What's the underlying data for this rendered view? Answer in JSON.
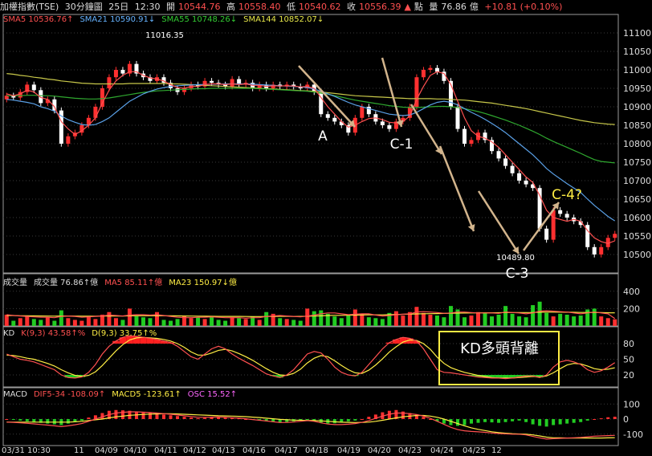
{
  "header": {
    "instrument": "加權指數(TSE)",
    "period": "30分鐘圖",
    "date": "25日",
    "time": "12:30",
    "open_label": "開",
    "open": "10544.76",
    "high_label": "高",
    "high": "10558.40",
    "low_label": "低",
    "low": "10540.62",
    "close_label": "收",
    "close": "10556.39",
    "unit": "點",
    "vol_label": "量",
    "vol": "76.86",
    "vol_unit": "億",
    "change": "+10.81 (+0.10%)"
  },
  "price_legend": [
    {
      "text": "SMA5 10536.76↑",
      "color": "#ff5050"
    },
    {
      "text": "SMA21 10590.91↓",
      "color": "#66b3ff"
    },
    {
      "text": "SMA55 10748.26↓",
      "color": "#33cc33"
    },
    {
      "text": "SMA144 10852.07↓",
      "color": "#e8e84a"
    }
  ],
  "volume_legend": [
    {
      "text": "成交量",
      "color": "#dddddd"
    },
    {
      "text": "成交量 76.86↑億",
      "color": "#dddddd"
    },
    {
      "text": "MA5 85.11↑億",
      "color": "#ff5050"
    },
    {
      "text": "MA23 150.97↓億",
      "color": "#ffee44"
    }
  ],
  "kd_legend": [
    {
      "text": "KD",
      "color": "#dddddd"
    },
    {
      "text": "K(9,3) 43.58↑%",
      "color": "#ff5050"
    },
    {
      "text": "D(9,3) 33.75↑%",
      "color": "#ffee44"
    }
  ],
  "macd_legend": [
    {
      "text": "MACD",
      "color": "#dddddd"
    },
    {
      "text": "DIF5-34 -108.09↑",
      "color": "#ff5050"
    },
    {
      "text": "MACD5 -123.61↑",
      "color": "#ffee44"
    },
    {
      "text": "OSC 15.52↑",
      "color": "#ff66ff"
    }
  ],
  "annotations": {
    "high_label": "11016.35",
    "low_label": "10489.80",
    "wave_a": "A",
    "wave_c1": "C-1",
    "wave_c3": "C-3",
    "wave_c4": "C-4?",
    "kd_box": "KD多頭背離"
  },
  "chart_data": [
    {
      "type": "candlestick",
      "title": "加權指數(TSE) 30分鐘圖",
      "ylim": [
        10450,
        11150
      ],
      "y_ticks": [
        11100,
        11050,
        11000,
        10950,
        10900,
        10850,
        10800,
        10750,
        10700,
        10650,
        10600,
        10550,
        10500
      ],
      "x_labels": [
        "03/31 10:30",
        "11",
        "04/09",
        "04/10",
        "04/11",
        "04/12",
        "04/13",
        "04/16",
        "04/17",
        "04/18",
        "04/19",
        "04/20",
        "04/23",
        "04/24",
        "04/25",
        "12"
      ],
      "close_path": [
        10930,
        10925,
        10940,
        10960,
        10945,
        10910,
        10920,
        10890,
        10800,
        10820,
        10830,
        10850,
        10870,
        10900,
        10950,
        10980,
        11000,
        10990,
        11016,
        10990,
        10980,
        10970,
        10980,
        10965,
        10950,
        10940,
        10950,
        10960,
        10955,
        10970,
        10965,
        10960,
        10955,
        10975,
        10960,
        10965,
        10950,
        10960,
        10950,
        10960,
        10955,
        10960,
        10955,
        10950,
        10960,
        10940,
        10880,
        10870,
        10860,
        10850,
        10830,
        10870,
        10900,
        10880,
        10860,
        10850,
        10840,
        10860,
        10870,
        10900,
        10980,
        11000,
        11005,
        10995,
        10970,
        10900,
        10840,
        10800,
        10810,
        10830,
        10810,
        10780,
        10760,
        10740,
        10720,
        10700,
        10690,
        10680,
        10570,
        10540,
        10620,
        10610,
        10600,
        10590,
        10580,
        10520,
        10500,
        10520,
        10545,
        10556
      ],
      "sma5": [
        10935,
        10930,
        10935,
        10945,
        10940,
        10925,
        10920,
        10900,
        10860,
        10840,
        10825,
        10835,
        10850,
        10870,
        10910,
        10945,
        10970,
        10985,
        10995,
        10995,
        10985,
        10978,
        10975,
        10970,
        10960,
        10952,
        10950,
        10955,
        10955,
        10960,
        10962,
        10962,
        10960,
        10962,
        10960,
        10962,
        10958,
        10958,
        10955,
        10957,
        10956,
        10957,
        10956,
        10954,
        10955,
        10950,
        10925,
        10900,
        10880,
        10860,
        10845,
        10850,
        10860,
        10868,
        10870,
        10865,
        10858,
        10856,
        10860,
        10875,
        10920,
        10955,
        10985,
        10995,
        10990,
        10960,
        10915,
        10870,
        10835,
        10820,
        10815,
        10805,
        10790,
        10770,
        10750,
        10730,
        10710,
        10695,
        10660,
        10620,
        10600,
        10595,
        10590,
        10595,
        10590,
        10565,
        10545,
        10535,
        10530,
        10537
      ],
      "sma21": [
        10920,
        10918,
        10915,
        10912,
        10908,
        10900,
        10895,
        10888,
        10875,
        10865,
        10858,
        10852,
        10850,
        10852,
        10860,
        10870,
        10885,
        10900,
        10915,
        10925,
        10935,
        10942,
        10948,
        10952,
        10955,
        10957,
        10958,
        10959,
        10960,
        10960,
        10961,
        10961,
        10962,
        10962,
        10962,
        10962,
        10961,
        10960,
        10959,
        10958,
        10957,
        10956,
        10955,
        10954,
        10952,
        10948,
        10942,
        10935,
        10928,
        10920,
        10912,
        10905,
        10900,
        10895,
        10890,
        10885,
        10880,
        10878,
        10876,
        10878,
        10885,
        10895,
        10905,
        10912,
        10915,
        10912,
        10905,
        10895,
        10885,
        10876,
        10866,
        10855,
        10843,
        10830,
        10815,
        10800,
        10785,
        10770,
        10752,
        10733,
        10718,
        10705,
        10692,
        10680,
        10668,
        10650,
        10633,
        10618,
        10603,
        10591
      ],
      "sma55": [
        10930,
        10930,
        10930,
        10931,
        10931,
        10930,
        10930,
        10929,
        10927,
        10925,
        10923,
        10922,
        10921,
        10921,
        10922,
        10924,
        10927,
        10930,
        10933,
        10936,
        10939,
        10941,
        10943,
        10944,
        10945,
        10946,
        10947,
        10948,
        10949,
        10949,
        10950,
        10950,
        10950,
        10950,
        10950,
        10950,
        10950,
        10949,
        10948,
        10947,
        10946,
        10945,
        10944,
        10943,
        10942,
        10940,
        10937,
        10934,
        10930,
        10926,
        10922,
        10918,
        10915,
        10912,
        10909,
        10906,
        10903,
        10901,
        10899,
        10898,
        10898,
        10899,
        10900,
        10901,
        10901,
        10900,
        10898,
        10895,
        10891,
        10887,
        10882,
        10876,
        10870,
        10864,
        10857,
        10850,
        10842,
        10834,
        10825,
        10815,
        10806,
        10798,
        10790,
        10782,
        10774,
        10765,
        10757,
        10752,
        10750,
        10748
      ],
      "sma144": [
        10990,
        10988,
        10985,
        10983,
        10980,
        10978,
        10975,
        10973,
        10970,
        10968,
        10966,
        10964,
        10963,
        10962,
        10962,
        10962,
        10962,
        10962,
        10963,
        10963,
        10963,
        10963,
        10963,
        10963,
        10962,
        10962,
        10961,
        10960,
        10959,
        10958,
        10957,
        10956,
        10955,
        10954,
        10953,
        10952,
        10951,
        10950,
        10949,
        10948,
        10947,
        10946,
        10945,
        10944,
        10943,
        10942,
        10940,
        10938,
        10936,
        10934,
        10932,
        10930,
        10929,
        10928,
        10927,
        10926,
        10925,
        10924,
        10923,
        10922,
        10922,
        10922,
        10922,
        10921,
        10921,
        10920,
        10919,
        10918,
        10916,
        10914,
        10912,
        10910,
        10907,
        10904,
        10901,
        10898,
        10895,
        10891,
        10887,
        10883,
        10879,
        10875,
        10871,
        10867,
        10863,
        10860,
        10857,
        10855,
        10853,
        10852
      ]
    },
    {
      "type": "bar",
      "title": "成交量",
      "ylim": [
        0,
        500
      ],
      "y_ticks": [
        400,
        200
      ],
      "values": [
        130,
        60,
        90,
        120,
        80,
        70,
        100,
        60,
        180,
        90,
        70,
        60,
        110,
        80,
        130,
        160,
        90,
        70,
        200,
        110,
        100,
        90,
        160,
        70,
        60,
        80,
        120,
        90,
        100,
        80,
        110,
        70,
        60,
        100,
        90,
        80,
        110,
        70,
        160,
        140,
        90,
        80,
        70,
        60,
        200,
        170,
        180,
        140,
        110,
        90,
        130,
        190,
        140,
        100,
        90,
        80,
        150,
        170,
        120,
        160,
        220,
        150,
        130,
        120,
        100,
        230,
        190,
        100,
        120,
        160,
        150,
        110,
        130,
        230,
        140,
        110,
        100,
        240,
        280,
        150,
        110,
        140,
        130,
        110,
        120,
        190,
        200,
        110,
        90,
        76.86
      ],
      "ma5": [
        130,
        120,
        115,
        110,
        105,
        100,
        100,
        95,
        110,
        115,
        110,
        100,
        105,
        110,
        115,
        125,
        120,
        115,
        125,
        130,
        130,
        125,
        130,
        120,
        110,
        100,
        95,
        95,
        100,
        100,
        105,
        100,
        95,
        95,
        95,
        90,
        95,
        95,
        110,
        115,
        120,
        115,
        110,
        105,
        115,
        125,
        140,
        150,
        150,
        140,
        130,
        135,
        140,
        140,
        125,
        115,
        120,
        130,
        135,
        140,
        160,
        165,
        160,
        155,
        145,
        150,
        160,
        160,
        155,
        150,
        150,
        150,
        145,
        160,
        155,
        150,
        140,
        150,
        170,
        175,
        170,
        165,
        160,
        150,
        140,
        150,
        160,
        150,
        140,
        85.11
      ],
      "ma23": [
        120,
        120,
        118,
        118,
        116,
        115,
        114,
        113,
        115,
        115,
        114,
        113,
        113,
        113,
        114,
        115,
        115,
        115,
        117,
        118,
        118,
        118,
        119,
        118,
        117,
        116,
        115,
        114,
        113,
        112,
        111,
        110,
        110,
        110,
        110,
        109,
        108,
        108,
        109,
        110,
        111,
        111,
        110,
        110,
        112,
        114,
        117,
        120,
        122,
        122,
        123,
        125,
        127,
        128,
        128,
        128,
        130,
        132,
        134,
        136,
        139,
        141,
        142,
        143,
        144,
        146,
        148,
        149,
        150,
        151,
        152,
        152,
        153,
        155,
        155,
        155,
        155,
        156,
        158,
        159,
        159,
        159,
        158,
        157,
        156,
        156,
        155,
        154,
        152,
        150.97
      ]
    },
    {
      "type": "line",
      "title": "KD",
      "ylim": [
        0,
        100
      ],
      "y_ticks": [
        80,
        50,
        20
      ],
      "k": [
        60,
        55,
        50,
        48,
        45,
        40,
        35,
        30,
        20,
        15,
        14,
        16,
        25,
        40,
        60,
        75,
        85,
        92,
        95,
        94,
        92,
        90,
        88,
        85,
        82,
        75,
        65,
        55,
        50,
        60,
        70,
        75,
        70,
        60,
        52,
        45,
        38,
        30,
        22,
        18,
        15,
        20,
        30,
        45,
        60,
        65,
        62,
        50,
        35,
        25,
        20,
        18,
        25,
        40,
        55,
        70,
        82,
        88,
        92,
        90,
        85,
        70,
        50,
        30,
        25,
        24,
        22,
        20,
        18,
        16,
        15,
        14,
        14,
        13,
        14,
        16,
        18,
        18,
        15,
        20,
        35,
        45,
        48,
        45,
        40,
        30,
        25,
        28,
        35,
        43.58
      ],
      "d": [
        58,
        57,
        55,
        52,
        50,
        46,
        42,
        37,
        30,
        24,
        19,
        17,
        19,
        26,
        38,
        52,
        66,
        78,
        87,
        91,
        92,
        91,
        90,
        88,
        85,
        80,
        73,
        64,
        58,
        58,
        62,
        67,
        69,
        66,
        61,
        55,
        48,
        40,
        32,
        25,
        20,
        19,
        23,
        31,
        43,
        52,
        57,
        55,
        47,
        38,
        30,
        24,
        23,
        29,
        39,
        51,
        64,
        74,
        83,
        87,
        86,
        80,
        69,
        54,
        42,
        34,
        29,
        25,
        22,
        19,
        17,
        15,
        14,
        14,
        14,
        15,
        16,
        17,
        16,
        18,
        24,
        32,
        39,
        42,
        41,
        37,
        32,
        30,
        31,
        33.75
      ]
    },
    {
      "type": "bar",
      "title": "MACD",
      "ylim": [
        -160,
        160
      ],
      "y_ticks": [
        100,
        0,
        -100
      ],
      "osc": [
        0,
        -5,
        -10,
        -15,
        -20,
        -25,
        -30,
        -35,
        -40,
        -30,
        -20,
        -10,
        10,
        25,
        40,
        55,
        60,
        58,
        55,
        50,
        45,
        40,
        35,
        30,
        25,
        20,
        15,
        10,
        5,
        8,
        12,
        15,
        12,
        8,
        5,
        0,
        -5,
        -10,
        -15,
        -20,
        -25,
        -20,
        -15,
        -10,
        -5,
        -15,
        -25,
        -30,
        -28,
        -22,
        -15,
        -10,
        0,
        15,
        30,
        45,
        55,
        60,
        50,
        40,
        30,
        15,
        0,
        -15,
        -30,
        -40,
        -45,
        -40,
        -30,
        -25,
        -20,
        -22,
        -25,
        -20,
        -15,
        -10,
        -20,
        -35,
        -45,
        -50,
        -40,
        -35,
        -30,
        -25,
        -20,
        -10,
        0,
        5,
        12,
        15.52
      ],
      "dif": [
        -20,
        -22,
        -25,
        -28,
        -32,
        -36,
        -40,
        -45,
        -50,
        -45,
        -38,
        -30,
        -15,
        0,
        15,
        30,
        40,
        45,
        48,
        48,
        46,
        43,
        40,
        36,
        32,
        27,
        22,
        17,
        12,
        12,
        13,
        14,
        12,
        9,
        6,
        2,
        -3,
        -8,
        -13,
        -18,
        -23,
        -22,
        -19,
        -15,
        -10,
        -15,
        -25,
        -33,
        -37,
        -37,
        -34,
        -30,
        -22,
        -10,
        5,
        20,
        32,
        40,
        40,
        36,
        30,
        20,
        5,
        -15,
        -35,
        -55,
        -70,
        -78,
        -82,
        -85,
        -88,
        -92,
        -96,
        -98,
        -100,
        -100,
        -105,
        -115,
        -125,
        -133,
        -130,
        -128,
        -126,
        -124,
        -122,
        -118,
        -114,
        -112,
        -110,
        -108.09
      ],
      "macd": [
        -20,
        -20,
        -20,
        -20,
        -20,
        -20,
        -20,
        -20,
        -20,
        -20,
        -18,
        -15,
        -10,
        -5,
        0,
        8,
        15,
        20,
        25,
        28,
        31,
        33,
        34,
        35,
        35,
        34,
        32,
        30,
        28,
        26,
        24,
        22,
        21,
        20,
        18,
        16,
        13,
        10,
        6,
        2,
        -2,
        -5,
        -7,
        -8,
        -9,
        -10,
        -12,
        -15,
        -18,
        -21,
        -22,
        -23,
        -22,
        -20,
        -15,
        -8,
        0,
        8,
        15,
        20,
        24,
        24,
        20,
        12,
        0,
        -15,
        -30,
        -45,
        -58,
        -68,
        -76,
        -84,
        -90,
        -94,
        -97,
        -99,
        -101,
        -105,
        -112,
        -120,
        -124,
        -125,
        -126,
        -126,
        -126,
        -126,
        -126,
        -126,
        -125,
        -123.61
      ]
    }
  ]
}
